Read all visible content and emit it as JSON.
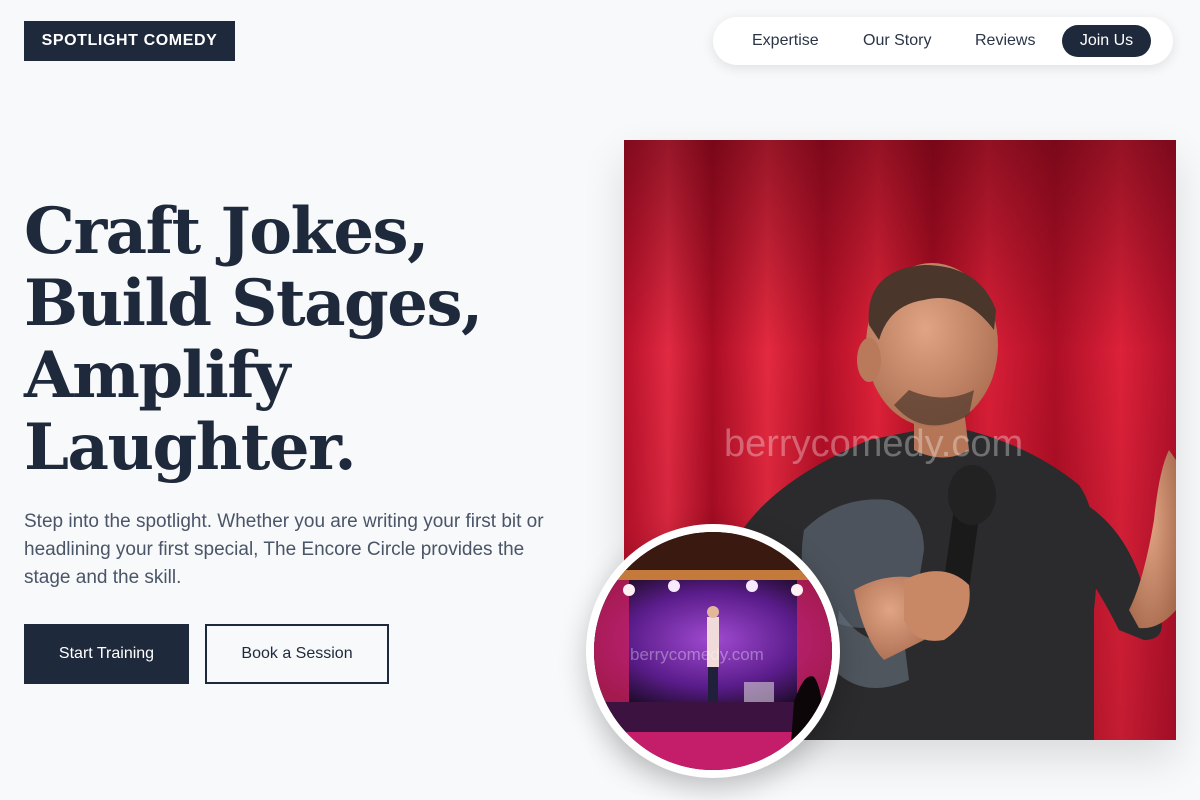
{
  "brand": {
    "logo_text": "SPOTLIGHT COMEDY"
  },
  "nav": {
    "items": [
      "Expertise",
      "Our Story",
      "Reviews"
    ],
    "cta": "Join Us"
  },
  "hero": {
    "headline_lines": [
      "Craft Jokes,",
      "Build Stages,",
      "Amplify",
      "Laughter."
    ],
    "lead": "Step into the spotlight. Whether you are writing your first bit or headlining your first special, The Encore Circle provides the stage and the skill.",
    "primary_button": "Start Training",
    "secondary_button": "Book a Session",
    "main_image": {
      "watermark": "berrycomedy.com"
    },
    "inset_image": {
      "watermark": "berrycomedy.com"
    }
  },
  "colors": {
    "navy": "#1e293b",
    "background": "#f8f9fa",
    "curtain_red": "#d41a34"
  }
}
